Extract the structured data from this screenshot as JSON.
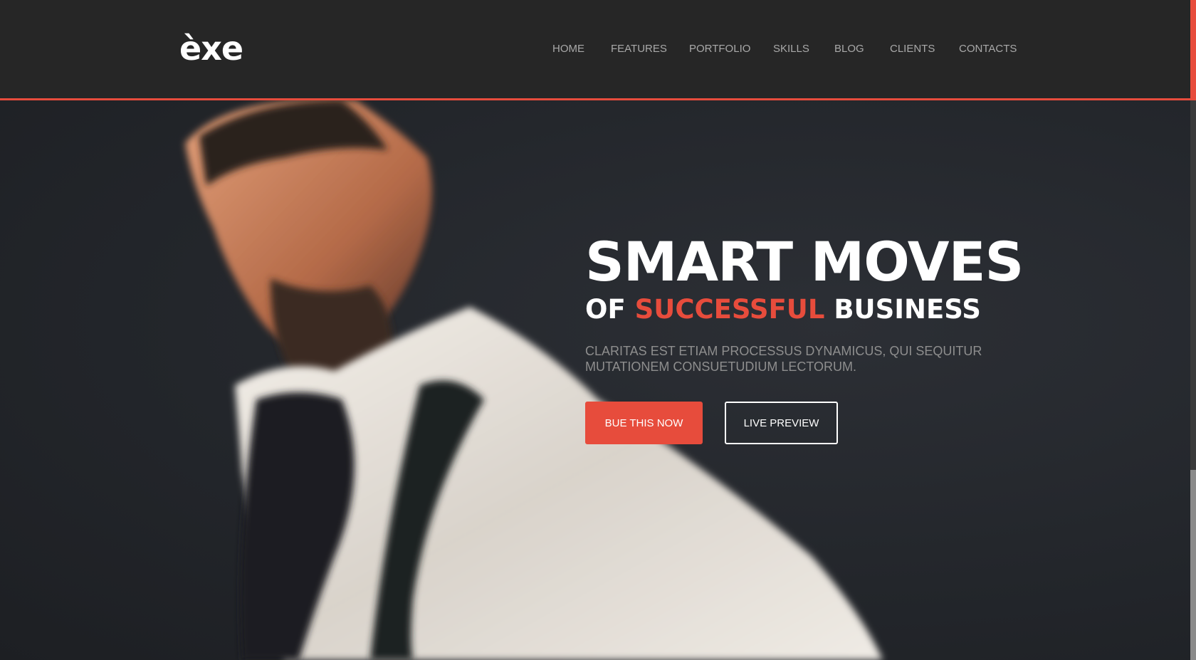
{
  "header": {
    "logo": "èxe",
    "nav": [
      {
        "label": "HOME",
        "name": "nav-home"
      },
      {
        "label": "FEATURES",
        "name": "nav-features"
      },
      {
        "label": "PORTFOLIO",
        "name": "nav-portfolio"
      },
      {
        "label": "SKILLS",
        "name": "nav-skills"
      },
      {
        "label": "BLOG",
        "name": "nav-blog"
      },
      {
        "label": "CLIENTS",
        "name": "nav-clients"
      },
      {
        "label": "CONTACTS",
        "name": "nav-contacts"
      }
    ]
  },
  "hero": {
    "headline": "SMART MOVES",
    "sub_prefix": "OF ",
    "sub_accent": "SUCCESSFUL",
    "sub_suffix": " BUSINESS",
    "tagline": "CLARITAS EST ETIAM PROCESSUS DYNAMICUS, QUI SEQUITUR MUTATIONEM CONSUETUDIUM LECTORUM.",
    "primary_button": "BUE THIS NOW",
    "secondary_button": "LIVE PREVIEW"
  },
  "colors": {
    "accent": "#e74c3c",
    "background": "#262626",
    "text": "#ffffff",
    "muted": "#8e8e8e"
  }
}
